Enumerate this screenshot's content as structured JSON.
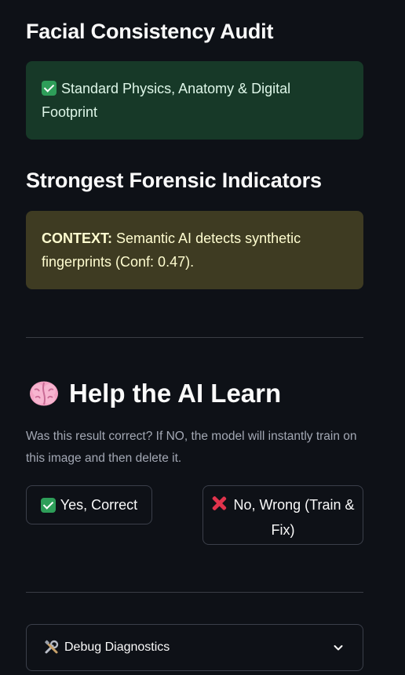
{
  "audit": {
    "heading": "Facial Consistency Audit",
    "status_icon": "check-icon",
    "status_text": "Standard Physics, Anatomy & Digital Footprint",
    "status_color": "#173928"
  },
  "indicators": {
    "heading": "Strongest Forensic Indicators",
    "label": "CONTEXT:",
    "text": "Semantic AI detects synthetic fingerprints (Conf: 0.47).",
    "color": "#3e3b22"
  },
  "feedback": {
    "icon": "brain-icon",
    "heading": "Help the AI Learn",
    "caption": "Was this result correct? If NO, the model will instantly train on this image and then delete it.",
    "yes_icon": "check-icon",
    "yes_label": "Yes, Correct",
    "no_icon": "x-icon",
    "no_label": "No, Wrong (Train & Fix)"
  },
  "debug": {
    "icon": "tools-icon",
    "label": "Debug Diagnostics",
    "chevron": "chevron-down-icon",
    "expanded": false
  }
}
